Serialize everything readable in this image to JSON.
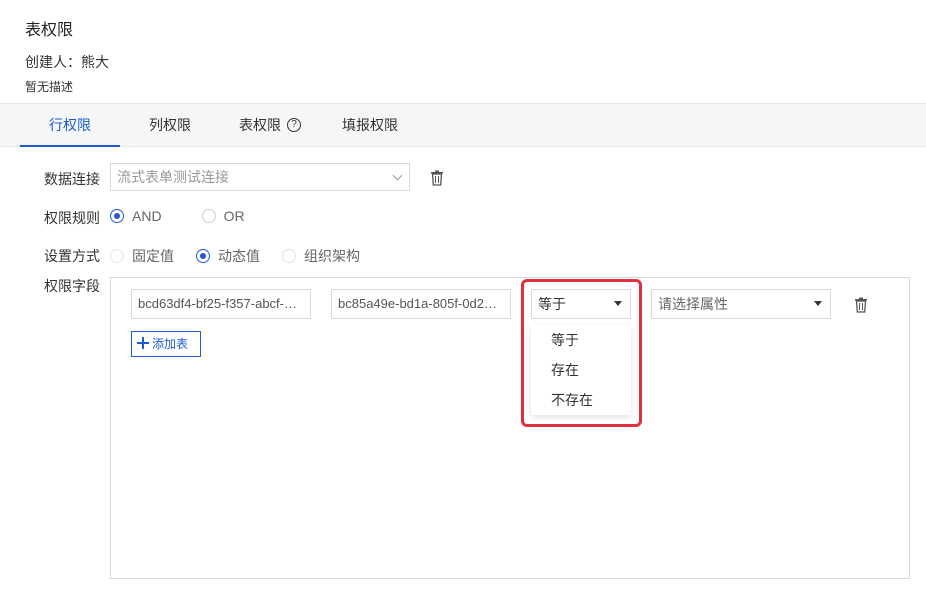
{
  "header": {
    "title": "表权限",
    "creator": "创建人：熊大",
    "description": "暂无描述"
  },
  "tabs": [
    {
      "label": "行权限",
      "active": true
    },
    {
      "label": "列权限",
      "active": false
    },
    {
      "label": "表权限",
      "active": false
    },
    {
      "label": "填报权限",
      "active": false
    }
  ],
  "help_icon_glyph": "?",
  "form": {
    "data_connection": {
      "label": "数据连接",
      "value": "流式表单测试连接"
    },
    "rule": {
      "label": "权限规则",
      "options": [
        "AND",
        "OR"
      ],
      "selected": "AND"
    },
    "mode": {
      "label": "设置方式",
      "options": [
        "固定值",
        "动态值",
        "组织架构"
      ],
      "selected": "动态值"
    },
    "fields": {
      "label": "权限字段",
      "row": {
        "table": "bcd63df4-bf25-f357-abcf-…",
        "column": "bc85a49e-bd1a-805f-0d2…",
        "operator": "等于",
        "attribute_placeholder": "请选择属性"
      },
      "add_label": "添加表"
    }
  },
  "operator_dropdown": [
    "等于",
    "存在",
    "不存在"
  ],
  "colors": {
    "accent": "#1e5bd3",
    "highlight": "#e0303d"
  }
}
